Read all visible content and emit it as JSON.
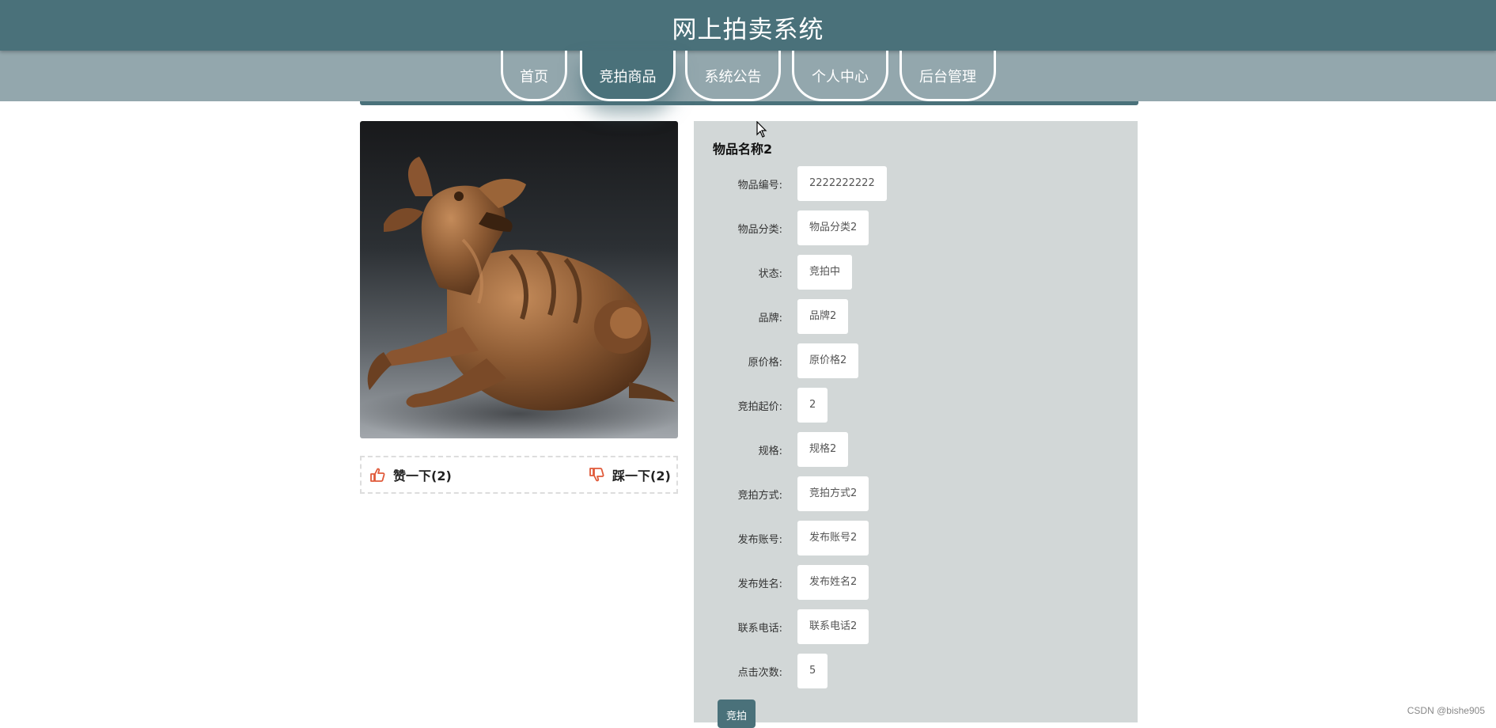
{
  "header": {
    "title": "网上拍卖系统"
  },
  "nav": {
    "items": [
      {
        "label": "首页"
      },
      {
        "label": "竞拍商品"
      },
      {
        "label": "系统公告"
      },
      {
        "label": "个人中心"
      },
      {
        "label": "后台管理"
      }
    ],
    "active_index": 1
  },
  "product": {
    "image_icon": "bronze-pixiu-statue-image",
    "votes": {
      "like_label": "赞一下(2)",
      "dislike_label": "踩一下(2)",
      "like_icon": "thumbs-up-icon",
      "dislike_icon": "thumbs-down-icon"
    }
  },
  "details": {
    "name": "物品名称2",
    "fields": [
      {
        "label": "物品编号:",
        "value": "2222222222"
      },
      {
        "label": "物品分类:",
        "value": "物品分类2"
      },
      {
        "label": "状态:",
        "value": "竞拍中"
      },
      {
        "label": "品牌:",
        "value": "品牌2"
      },
      {
        "label": "原价格:",
        "value": "原价格2"
      },
      {
        "label": "竞拍起价:",
        "value": "2"
      },
      {
        "label": "规格:",
        "value": "规格2"
      },
      {
        "label": "竞拍方式:",
        "value": "竞拍方式2"
      },
      {
        "label": "发布账号:",
        "value": "发布账号2"
      },
      {
        "label": "发布姓名:",
        "value": "发布姓名2"
      },
      {
        "label": "联系电话:",
        "value": "联系电话2"
      },
      {
        "label": "点击次数:",
        "value": "5"
      }
    ],
    "bid_button_label": "竞拍"
  },
  "footer": {
    "watermark": "CSDN @bishe905"
  },
  "colors": {
    "header_bg": "#4a717a",
    "nav_bg": "#93a7ad",
    "panel_bg": "#d2d7d7",
    "vote_icon": "#e05a3a"
  }
}
